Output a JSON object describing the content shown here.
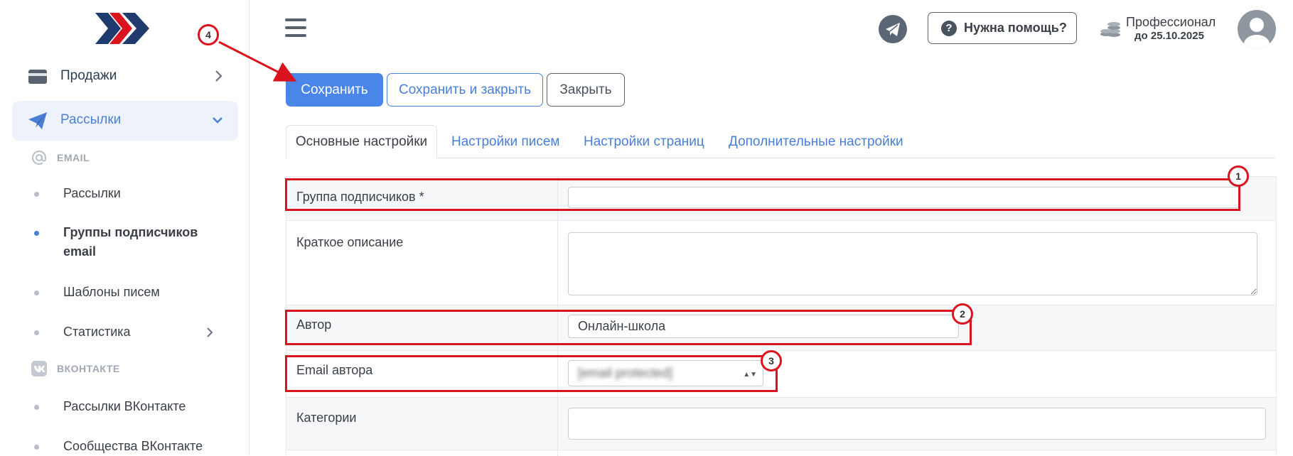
{
  "sidebar": {
    "sales": "Продажи",
    "mailings": "Рассылки",
    "email_section": "EMAIL",
    "email_items": [
      "Рассылки",
      "Группы подписчиков email",
      "Шаблоны писем",
      "Статистика"
    ],
    "vk_section": "ВКОНТАКТЕ",
    "vk_items": [
      "Рассылки ВКонтакте",
      "Сообщества ВКонтакте"
    ]
  },
  "header": {
    "help_label": "Нужна помощь?",
    "plan_name": "Профессионал",
    "plan_until": "до 25.10.2025"
  },
  "toolbar": {
    "save": "Сохранить",
    "save_close": "Сохранить и закрыть",
    "close": "Закрыть"
  },
  "tabs": [
    "Основные настройки",
    "Настройки писем",
    "Настройки страниц",
    "Дополнительные настройки"
  ],
  "form": {
    "group_label": "Группа подписчиков *",
    "group_value": "",
    "description_label": "Краткое описание",
    "description_value": "",
    "author_label": "Автор",
    "author_value": "Онлайн-школа",
    "author_email_label": "Email автора",
    "author_email_value": "[email protected]",
    "categories_label": "Категории",
    "categories_value": ""
  },
  "annotations": [
    "1",
    "2",
    "3",
    "4"
  ],
  "colors": {
    "accent": "#4a86e8",
    "annotation": "#d9141e",
    "logo_dark": "#1f3a6e",
    "logo_red": "#d9141e"
  }
}
